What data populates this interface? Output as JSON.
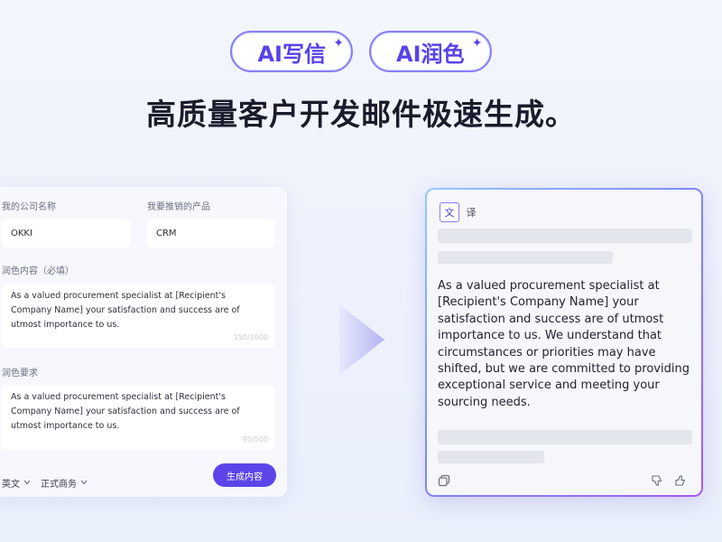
{
  "hero": {
    "pills": [
      {
        "label": "AI写信"
      },
      {
        "label": "AI润色"
      }
    ],
    "sparkle": "✦",
    "headline": "高质量客户开发邮件极速生成。"
  },
  "form": {
    "company_label": "我的公司名称",
    "company_value": "OKKI",
    "product_label": "我要推销的产品",
    "product_value": "CRM",
    "content_label": "润色内容（必填）",
    "content_value": "As a valued procurement specialist at [Recipient's Company Name] your satisfaction and success are of utmost importance to us.",
    "content_counter": "150/1000",
    "requirement_label": "润色要求",
    "requirement_value": "As a valued procurement specialist at [Recipient's Company Name] your satisfaction and success are of utmost importance to us.",
    "requirement_counter": "95/500",
    "language_label": "英文",
    "tone_label": "正式商务",
    "generate_label": "生成内容"
  },
  "result": {
    "toggle_original": "文",
    "toggle_translate": "译",
    "body": "As a valued procurement specialist at [Recipient's Company Name] your satisfaction and success are of utmost importance to us. We understand that circumstances or priorities may have shifted, but we are committed to providing exceptional service and meeting your sourcing needs."
  },
  "icons": {
    "copy": "copy-icon",
    "dislike": "thumbs-down-icon",
    "like": "thumbs-up-icon",
    "arrow": "arrow-right-icon",
    "chevron": "chevron-down-icon"
  },
  "colors": {
    "accent": "#5b45e9",
    "pill_text": "#5743e8",
    "headline": "#1a1c2c",
    "background": "#eef2fc"
  }
}
